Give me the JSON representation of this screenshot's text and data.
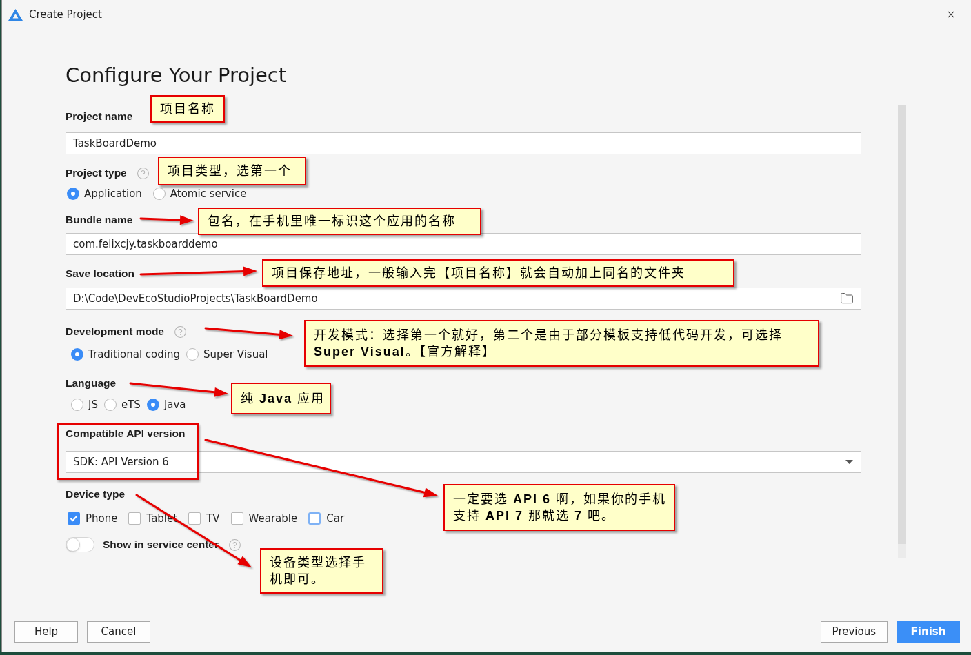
{
  "window": {
    "title": "Create Project"
  },
  "heading": "Configure Your Project",
  "sections": [
    {
      "kind": "text",
      "label": "Project name",
      "value": "TaskBoardDemo",
      "help": false,
      "highlighted": false
    },
    {
      "kind": "radio",
      "label": "Project type",
      "help": true,
      "highlighted": false,
      "options": [
        {
          "label": "Application",
          "selected": true
        },
        {
          "label": "Atomic service",
          "selected": false
        }
      ]
    },
    {
      "kind": "text",
      "label": "Bundle name",
      "value": "com.felixcjy.taskboarddemo",
      "help": false,
      "highlighted": false
    },
    {
      "kind": "folder",
      "label": "Save location",
      "value": "D:\\Code\\DevEcoStudioProjects\\TaskBoardDemo",
      "help": false,
      "highlighted": false
    },
    {
      "kind": "radio",
      "label": "Development mode",
      "help": true,
      "highlighted": false,
      "options": [
        {
          "label": "Traditional coding",
          "selected": true
        },
        {
          "label": "Super Visual",
          "selected": false
        }
      ]
    },
    {
      "kind": "radio",
      "label": "Language",
      "help": false,
      "highlighted": false,
      "options": [
        {
          "label": "JS",
          "selected": false
        },
        {
          "label": "eTS",
          "selected": false
        },
        {
          "label": "Java",
          "selected": true
        }
      ]
    },
    {
      "kind": "select",
      "label": "Compatible API version",
      "value": "SDK: API Version 6",
      "help": false,
      "highlighted": true
    },
    {
      "kind": "checkbox",
      "label": "Device type",
      "help": false,
      "highlighted": false,
      "options": [
        {
          "label": "Phone",
          "checked": true,
          "focused": false
        },
        {
          "label": "Tablet",
          "checked": false,
          "focused": false
        },
        {
          "label": "TV",
          "checked": false,
          "focused": false
        },
        {
          "label": "Wearable",
          "checked": false,
          "focused": false
        },
        {
          "label": "Car",
          "checked": false,
          "focused": true
        }
      ]
    },
    {
      "kind": "toggle",
      "label": "Show in service center",
      "on": false,
      "help": true,
      "highlighted": false
    }
  ],
  "footer": [
    {
      "label": "Help",
      "kind": "default"
    },
    {
      "label": "Cancel",
      "kind": "default"
    },
    {
      "label": "Previous",
      "kind": "default"
    },
    {
      "label": "Finish",
      "kind": "primary"
    }
  ],
  "annotations": [
    {
      "lines": [
        "项目名称"
      ],
      "arrow": false
    },
    {
      "lines": [
        "项目类型，选第一个"
      ],
      "arrow": false
    },
    {
      "lines": [
        "包名，在手机里唯一标识这个应用的名称"
      ],
      "arrow": true
    },
    {
      "lines": [
        "项目保存地址，一般输入完【项目名称】就会自动加上同名的文件夹"
      ],
      "arrow": true
    },
    {
      "lines": [
        "开发模式：选择第一个就好，第二个是由于部分模板支持低代码开发，可选择",
        "**Super Visual**。【官方解释】"
      ],
      "arrow": true
    },
    {
      "lines": [
        "纯 **Java** 应用"
      ],
      "arrow": true
    },
    {
      "lines": [
        "一定要选 **API 6** 啊，如果你的手机",
        "支持 **API 7** 那就选 **7** 吧。"
      ],
      "arrow": true
    },
    {
      "lines": [
        "设备类型选择手",
        "机即可。"
      ],
      "arrow": true
    }
  ]
}
